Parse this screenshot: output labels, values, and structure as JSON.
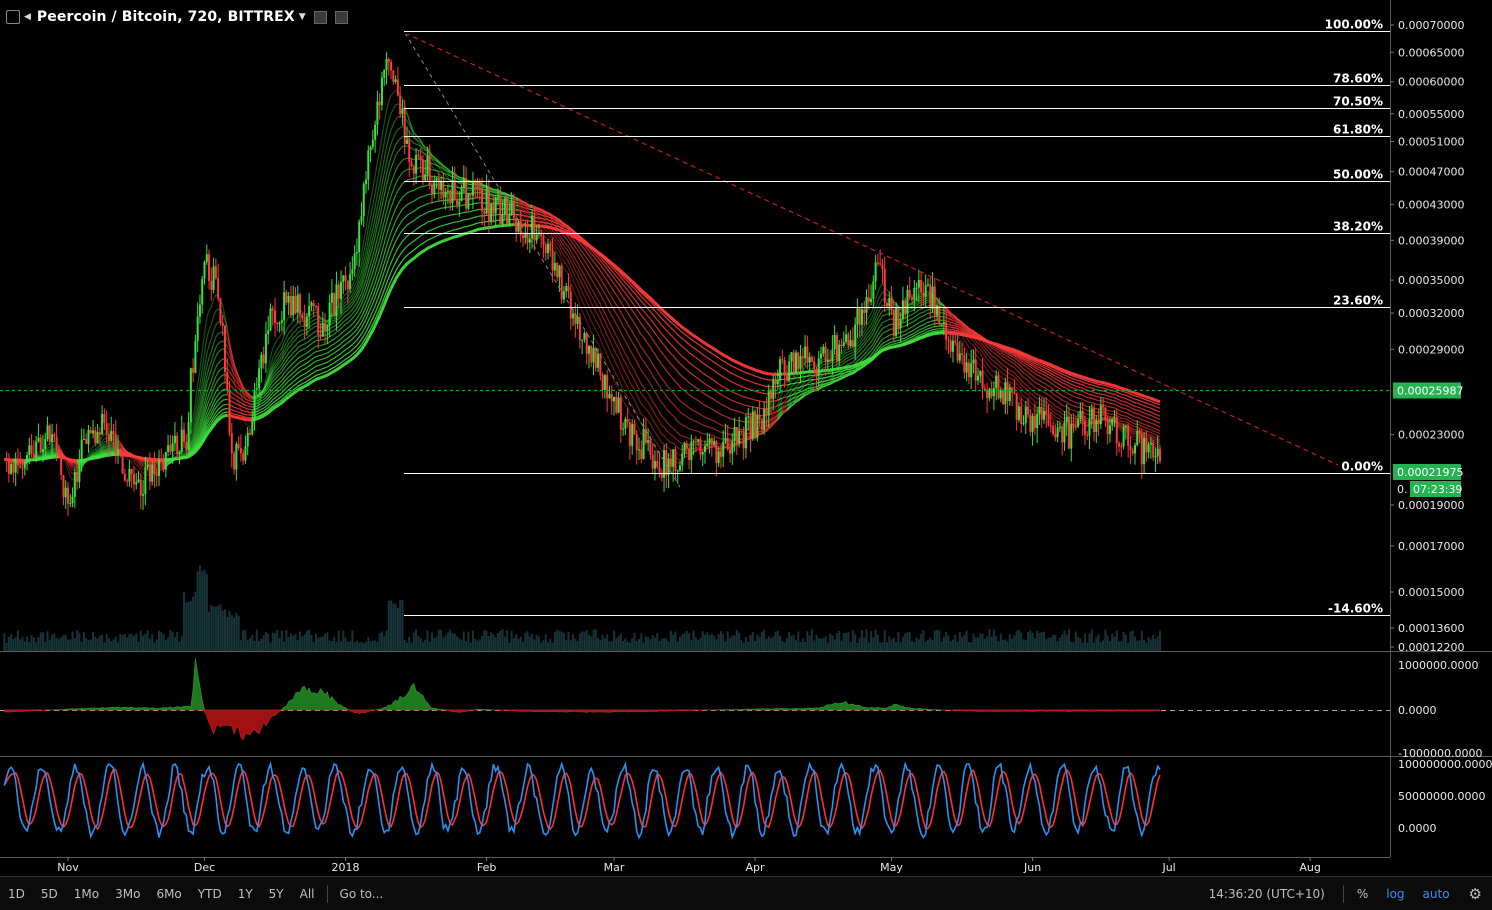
{
  "header": {
    "title": "Peercoin / Bitcoin, 720, BITTREX"
  },
  "colors": {
    "bull": "#3ee03e",
    "bear": "#ff3b3b",
    "fib_line": "#ffffff",
    "trend_dash": "#c02020",
    "price_line": "#00b800",
    "current_bg": "#25b352",
    "stoch_k": "#2f8ff0",
    "stoch_d": "#ff3030",
    "volume": "#2a5e68"
  },
  "chart_data": [
    {
      "type": "line",
      "subtype": "candlestick-with-ribbon",
      "title": "Peercoin / Bitcoin, 720, BITTREX",
      "y_scale": "log",
      "ylim": [
        0.000122,
        0.00072
      ],
      "y_ticks": [
        "0.00070000",
        "0.00065000",
        "0.00060000",
        "0.00055000",
        "0.00051000",
        "0.00047000",
        "0.00043000",
        "0.00039000",
        "0.00035000",
        "0.00032000",
        "0.00029000",
        "0.00023000",
        "0.00019000",
        "0.00017000",
        "0.00015000",
        "0.00013600",
        "0.00012200"
      ],
      "y_tick_values": [
        0.0007,
        0.00065,
        0.0006,
        0.00055,
        0.00051,
        0.00047,
        0.00043,
        0.00039,
        0.00035,
        0.00032,
        0.00029,
        0.00023,
        0.00019,
        0.00017,
        0.00015,
        0.000136,
        0.000122
      ],
      "x_ticks": [
        "Nov",
        "Dec",
        "2018",
        "Feb",
        "Mar",
        "Apr",
        "May",
        "Jun",
        "Jul",
        "Aug"
      ],
      "x_tick_days": [
        0,
        30,
        61,
        92,
        120,
        151,
        181,
        212,
        242,
        273
      ],
      "x_axis_note": "days since Nov 1, 2017",
      "series": [
        {
          "name": "price",
          "x": [
            -14,
            -4,
            0,
            4,
            8,
            12,
            16,
            22,
            26,
            30,
            33,
            36,
            40,
            44,
            48,
            52,
            56,
            60,
            63,
            66,
            70,
            74,
            76,
            78,
            80,
            84,
            88,
            92,
            96,
            100,
            104,
            108,
            112,
            116,
            120,
            124,
            128,
            132,
            136,
            140,
            144,
            148,
            152,
            156,
            160,
            164,
            168,
            172,
            176,
            178,
            181,
            184,
            188,
            192,
            196,
            200,
            204,
            208,
            212,
            216,
            220,
            224,
            228,
            232,
            236,
            240
          ],
          "y": [
            0.00021,
            0.00023,
            0.00019,
            0.00023,
            0.00024,
            0.00021,
            0.0002,
            0.00022,
            0.00023,
            0.00037,
            0.00034,
            0.00021,
            0.00023,
            0.00031,
            0.00033,
            0.00032,
            0.00031,
            0.00034,
            0.00037,
            0.00048,
            0.00064,
            0.00052,
            0.00047,
            0.00048,
            0.00046,
            0.00045,
            0.00044,
            0.00043,
            0.00042,
            0.00041,
            0.00039,
            0.00035,
            0.00031,
            0.00028,
            0.00025,
            0.00023,
            0.00022,
            0.00021,
            0.00022,
            0.00022,
            0.00022,
            0.00023,
            0.00024,
            0.00027,
            0.00028,
            0.00028,
            0.00029,
            0.0003,
            0.00033,
            0.00037,
            0.00031,
            0.00033,
            0.00034,
            0.00032,
            0.00028,
            0.00027,
            0.00026,
            0.00025,
            0.00024,
            0.00024,
            0.00023,
            0.00024,
            0.00024,
            0.00023,
            0.00022,
            0.00022
          ]
        }
      ],
      "fib_levels": [
        {
          "label": "100.00%",
          "value": 0.000688
        },
        {
          "label": "78.60%",
          "value": 0.000594
        },
        {
          "label": "70.50%",
          "value": 0.000558
        },
        {
          "label": "61.80%",
          "value": 0.000518
        },
        {
          "label": "50.00%",
          "value": 0.000458
        },
        {
          "label": "38.20%",
          "value": 0.000398
        },
        {
          "label": "23.60%",
          "value": 0.000325
        },
        {
          "label": "0.00%",
          "value": 0.000207
        },
        {
          "label": "-14.60%",
          "value": 0.000141
        }
      ],
      "price_line_label": "0.00025987",
      "current_price_label": "0.00021975",
      "countdown_label": "07:23:39",
      "countdown_prefix": "0."
    },
    {
      "type": "area",
      "name": "oscillator",
      "y_ticks": [
        "1000000.0000",
        "0.0000",
        "-1000000.0000"
      ],
      "y_tick_values": [
        1000000,
        0,
        -1000000
      ],
      "ylim": [
        -1050000,
        1100000
      ],
      "x": [
        -14,
        0,
        10,
        20,
        27,
        28,
        30,
        32,
        34,
        40,
        48,
        52,
        56,
        60,
        62,
        64,
        70,
        76,
        80,
        86,
        90,
        100,
        120,
        150,
        165,
        170,
        175,
        180,
        182,
        184,
        190,
        200,
        240
      ],
      "y": [
        -50000,
        20000,
        60000,
        40000,
        80000,
        950000,
        -40000,
        -500000,
        -350000,
        -600000,
        100000,
        500000,
        420000,
        100000,
        -20000,
        -80000,
        60000,
        480000,
        50000,
        -60000,
        20000,
        -30000,
        -50000,
        20000,
        40000,
        180000,
        60000,
        40000,
        140000,
        50000,
        10000,
        -30000,
        -20000
      ]
    },
    {
      "type": "line",
      "name": "stochastic",
      "y_ticks": [
        "100000000.0000",
        "50000000.0000",
        "0.0000"
      ],
      "y_tick_values": [
        100000000,
        50000000,
        0
      ],
      "ylim": [
        -42000000,
        108000000
      ]
    }
  ],
  "time_range_buttons": [
    "1D",
    "5D",
    "1Mo",
    "3Mo",
    "6Mo",
    "YTD",
    "1Y",
    "5Y",
    "All"
  ],
  "goto_label": "Go to...",
  "clock": "14:36:20 (UTC+10)",
  "scale_options": [
    "%",
    "log",
    "auto"
  ]
}
